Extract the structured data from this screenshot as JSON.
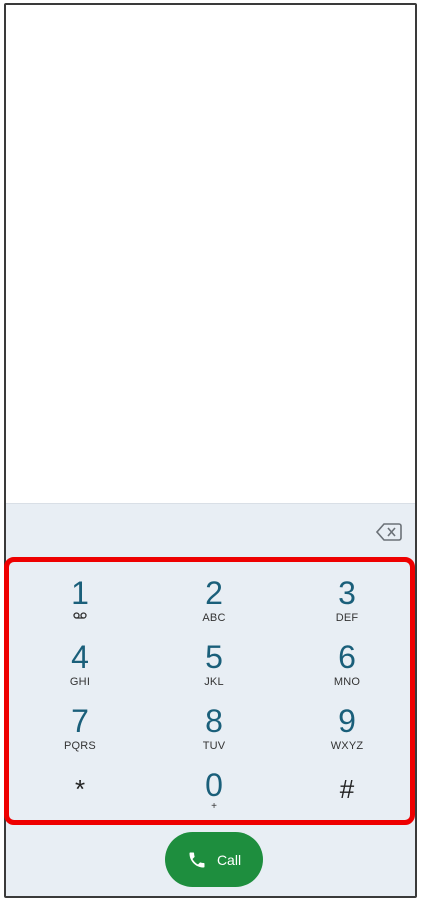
{
  "dialpad": {
    "keys": [
      {
        "digit": "1",
        "letters": "",
        "icon": "voicemail-icon"
      },
      {
        "digit": "2",
        "letters": "ABC"
      },
      {
        "digit": "3",
        "letters": "DEF"
      },
      {
        "digit": "4",
        "letters": "GHI"
      },
      {
        "digit": "5",
        "letters": "JKL"
      },
      {
        "digit": "6",
        "letters": "MNO"
      },
      {
        "digit": "7",
        "letters": "PQRS"
      },
      {
        "digit": "8",
        "letters": "TUV"
      },
      {
        "digit": "9",
        "letters": "WXYZ"
      },
      {
        "digit": "*",
        "letters": ""
      },
      {
        "digit": "0",
        "letters": "+"
      },
      {
        "digit": "#",
        "letters": ""
      }
    ],
    "backspace_icon": "backspace-icon"
  },
  "call_button": {
    "label": "Call",
    "icon": "phone-icon",
    "color": "#1e8e3e"
  },
  "colors": {
    "highlight": "#ee0000",
    "digit": "#1a5f7a",
    "pad_background": "#e8eef4"
  }
}
